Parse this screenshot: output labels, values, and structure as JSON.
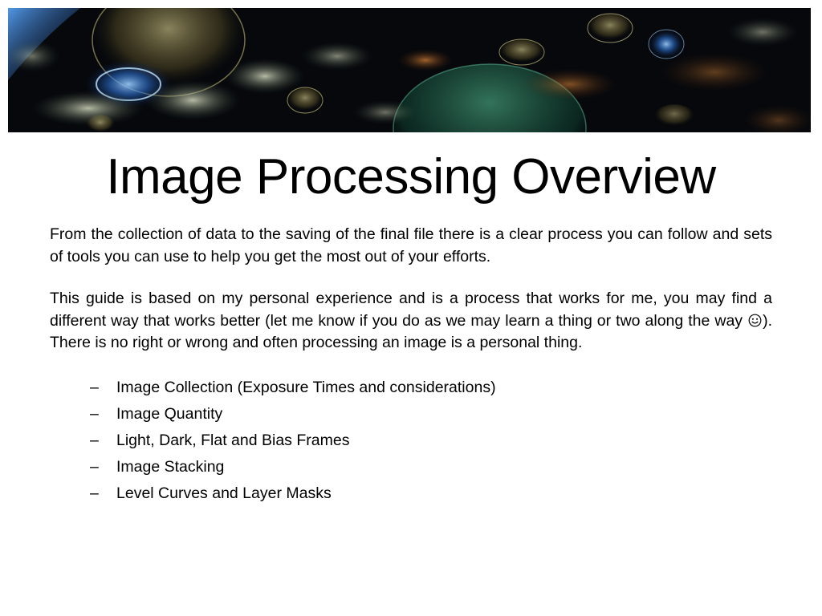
{
  "slide": {
    "title": "Image Processing Overview",
    "banner_icon": "space-nebula-banner",
    "paragraph_1": "From the collection of data to the saving of the final file there is a clear process you can follow and sets of tools you can use to help you get the most out of your efforts.",
    "paragraph_2_before": "This guide is based on my personal experience and is a process that works for me, you may find a different way that works better (let me know if you do as we may learn a thing or two along the way ",
    "paragraph_2_after": "). There is no right or wrong and often processing an image is a personal thing.",
    "smiley_icon": "smiley-face-icon",
    "bullet_marker": "–",
    "bullets": [
      "Image Collection (Exposure Times and considerations)",
      "Image Quantity",
      "Light, Dark, Flat and Bias Frames",
      "Image Stacking",
      "Level Curves and Layer Masks"
    ]
  }
}
